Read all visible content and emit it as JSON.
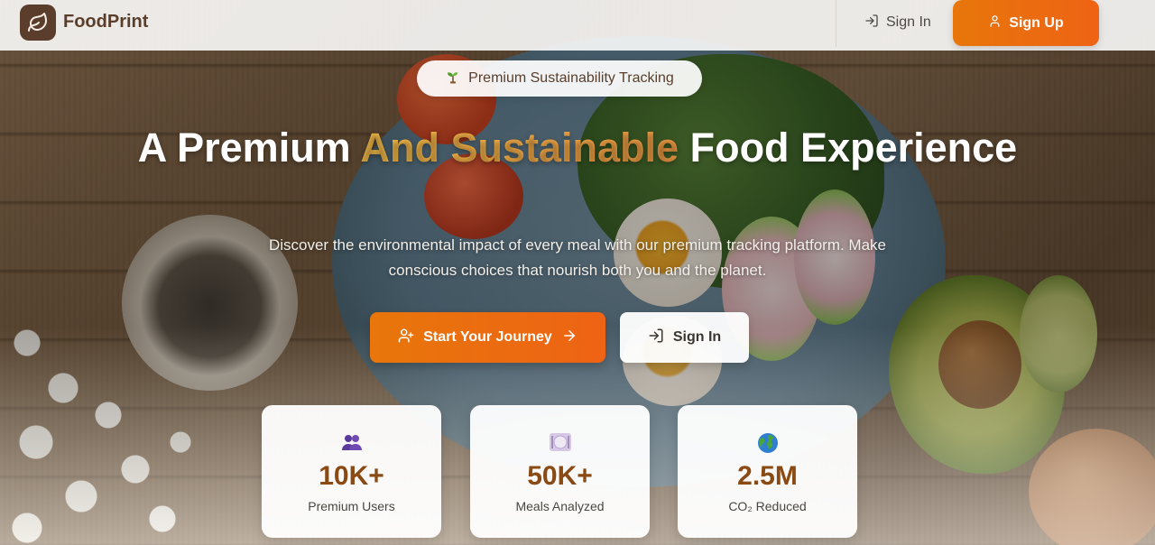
{
  "header": {
    "brand": "FoodPrint",
    "signin_label": "Sign In",
    "signup_label": "Sign Up"
  },
  "hero": {
    "badge": "Premium Sustainability Tracking",
    "headline_part1": "A Premium ",
    "headline_highlight": "And Sustainable",
    "headline_part2": " Food Experience",
    "subtitle": "Discover the environmental impact of every meal with our premium tracking platform. Make conscious choices that nourish both you and the planet.",
    "primary_button": "Start Your Journey",
    "secondary_button": "Sign In"
  },
  "stats": [
    {
      "icon": "users-icon",
      "value": "10K+",
      "label": "Premium Users"
    },
    {
      "icon": "plate-icon",
      "value": "50K+",
      "label": "Meals Analyzed"
    },
    {
      "icon": "globe-icon",
      "value": "2.5M",
      "label": "CO₂ Reduced"
    }
  ],
  "colors": {
    "accent": "#ee6314",
    "brand": "#5a3e2b",
    "highlight": "#f8b54a",
    "stat_value": "#8a4a14"
  }
}
